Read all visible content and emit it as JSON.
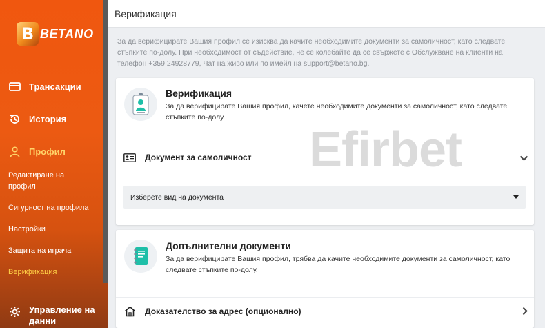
{
  "brand": {
    "logo_text": "BETANO",
    "logo_letter": "B"
  },
  "sidebar": {
    "main_items": [
      {
        "label": "Трансакции",
        "icon": "card-icon"
      },
      {
        "label": "История",
        "icon": "history-icon"
      },
      {
        "label": "Профил",
        "icon": "user-icon"
      }
    ],
    "sub_items": [
      "Редактиране на профил",
      "Сигурност на профила",
      "Настройки",
      "Защита на играча",
      "Верификация"
    ],
    "bottom_item": {
      "label": "Управление на данни",
      "icon": "settings-icon"
    },
    "active_color": "#ffd046"
  },
  "header": {
    "title": "Верификация"
  },
  "intro": "За да верифицирате Вашия профил се изисква да качите необходимите документи за самоличност, като следвате стъпките по-долу. При необходимост от съдействие, не се колебайте да се свържете с Обслужване на клиенти на телефон +359 24928779, Чат на живо или по имейл на support@betano.bg.",
  "verification_card": {
    "title": "Верификация",
    "description": "За да верифицирате Вашия профил, качете необходимите документи за самоличност, като следвате стъпките по-долу.",
    "row_label": "Документ за самоличност",
    "select_value": "Изберете вид на документа"
  },
  "additional_card": {
    "title": "Допълнителни документи",
    "description": "За да верифицирате Вашия профил, трябва да качите необходимите документи за самоличност, като следвате стъпките по-долу.",
    "row_label": "Доказателство за адрес (опционално)"
  },
  "watermark": "Efirbet",
  "colors": {
    "brand_orange": "#f0570f",
    "accent_yellow": "#ffd046",
    "background": "#edeff2"
  }
}
